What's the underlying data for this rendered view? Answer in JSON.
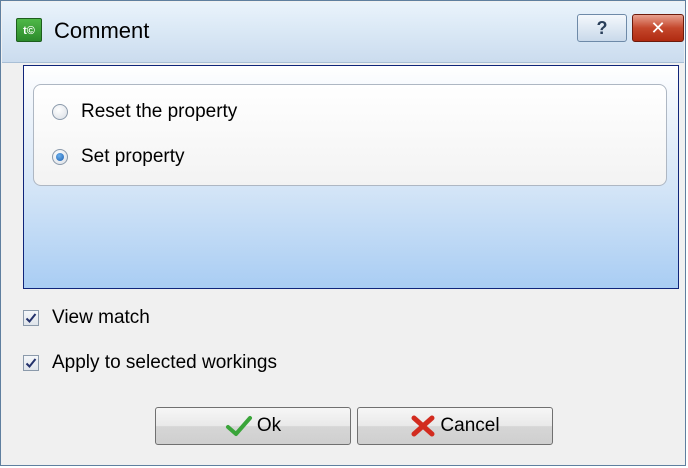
{
  "window": {
    "title": "Comment",
    "app_icon_text": "t©",
    "help_button_label": "?",
    "close_button_label": "✕"
  },
  "options": [
    {
      "label": "Reset the property",
      "selected": false
    },
    {
      "label": "Set property",
      "selected": true
    }
  ],
  "checkboxes": {
    "view_match": {
      "label": "View match",
      "checked": true
    },
    "apply_selected": {
      "label": "Apply to selected workings",
      "checked": true
    }
  },
  "buttons": {
    "ok_label": "Ok",
    "ok_icon": "checkmark-icon",
    "cancel_label": "Cancel",
    "cancel_icon": "red-x-icon"
  },
  "colors": {
    "panel_border": "#10257a",
    "ok_green": "#3aa53a",
    "cancel_red": "#d22b1f"
  }
}
